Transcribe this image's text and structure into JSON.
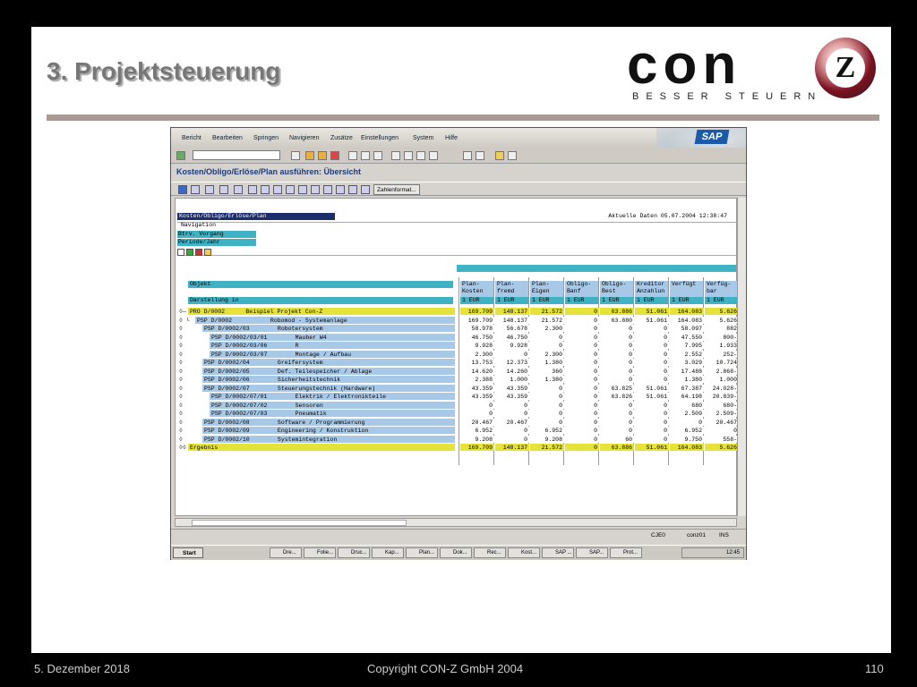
{
  "slide": {
    "title": "3. Projektsteuerung",
    "logo_word": "con",
    "logo_letter": "Z",
    "logo_tagline": "BESSER STEUERN",
    "footer_date": "5. Dezember 2018",
    "footer_copyright": "Copyright CON-Z GmbH 2004",
    "footer_page": "110"
  },
  "sap": {
    "menu": [
      "Bericht",
      "Bearbeiten",
      "Springen",
      "Navigieren",
      "Zusätze",
      "Einstellungen",
      "System",
      "Hilfe"
    ],
    "logo": "SAP",
    "screen_title": "Kosten/Obligo/Erlöse/Plan ausführen: Übersicht",
    "zahlenformat_button": "Zahlenformat...",
    "report_title": "Kosten/Obligo/Erlöse/Plan",
    "aktuell": "Aktuelle Daten 05.07.2004 12:38:47",
    "navigation_label": "Navigation",
    "nav_items": [
      "Btrv. Vorgang",
      "Periode/Jahr"
    ],
    "objekt_label": "Objekt",
    "darstellung_label": "Darstellung in",
    "columns": [
      {
        "l1": "Plan-",
        "l2": "Kosten",
        "unit": "1 EUR"
      },
      {
        "l1": "Plan-",
        "l2": "fremd",
        "unit": "1 EUR"
      },
      {
        "l1": "Plan-",
        "l2": "Eigen",
        "unit": "1 EUR"
      },
      {
        "l1": "Obligo-",
        "l2": "Banf",
        "unit": "1 EUR"
      },
      {
        "l1": "Obligo-",
        "l2": "Best",
        "unit": "1 EUR"
      },
      {
        "l1": "Kreditor",
        "l2": "Anzahlun",
        "unit": "1 EUR"
      },
      {
        "l1": "Verfügt",
        "l2": "",
        "unit": "1 EUR"
      },
      {
        "l1": "Verfüg-",
        "l2": "bar",
        "unit": "1 EUR"
      }
    ],
    "rows": [
      {
        "tree": "◊―",
        "label": "PRO D/0002      Beispiel Projekt Con-Z",
        "indent": 0,
        "hl": true,
        "values": [
          "169.709",
          "148.137",
          "21.572",
          "0",
          "63.886",
          "51.061",
          "164.083",
          "5.626"
        ]
      },
      {
        "tree": "◊ └",
        "label": "PSP D/0002           Robomod - Systemanlage",
        "indent": 1,
        "hl": false,
        "values": [
          "169.709",
          "148.137",
          "21.572",
          "0",
          "63.880",
          "51.061",
          "164.083",
          "5.626"
        ]
      },
      {
        "tree": "◊",
        "label": "PSP D/0002/03        Robotersystem",
        "indent": 2,
        "hl": false,
        "values": [
          "58.978",
          "56.678",
          "2.300",
          "0",
          "0",
          "0",
          "58.097",
          "882"
        ]
      },
      {
        "tree": "◊",
        "label": "PSP D/0002/03/01        Mauber W4",
        "indent": 3,
        "hl": false,
        "values": [
          "46.750",
          "46.750",
          "0",
          "0",
          "0",
          "0",
          "47.550",
          "800-"
        ]
      },
      {
        "tree": "◊",
        "label": "PSP D/0002/03/06        R",
        "indent": 3,
        "hl": false,
        "values": [
          "9.928",
          "9.928",
          "0",
          "0",
          "0",
          "0",
          "7.995",
          "1.933"
        ]
      },
      {
        "tree": "◊",
        "label": "PSP D/0002/03/07        Montage / Aufbau",
        "indent": 3,
        "hl": false,
        "values": [
          "2.300",
          "0",
          "2.300",
          "0",
          "0",
          "0",
          "2.552",
          "252-"
        ]
      },
      {
        "tree": "◊",
        "label": "PSP D/0002/04        Greifersystem",
        "indent": 2,
        "hl": false,
        "values": [
          "13.753",
          "12.373",
          "1.380",
          "0",
          "0",
          "0",
          "3.029",
          "10.724"
        ]
      },
      {
        "tree": "◊",
        "label": "PSP D/0002/05        Def. Teilespeicher / Ablage",
        "indent": 2,
        "hl": false,
        "values": [
          "14.620",
          "14.260",
          "360",
          "0",
          "0",
          "0",
          "17.488",
          "2.868-"
        ]
      },
      {
        "tree": "◊",
        "label": "PSP D/0002/06        Sicherheitstechnik",
        "indent": 2,
        "hl": false,
        "values": [
          "2.388",
          "1.000",
          "1.380",
          "0",
          "0",
          "0",
          "1.380",
          "1.000"
        ]
      },
      {
        "tree": "◊",
        "label": "PSP D/0002/07        Steuerungstechnik (Hardware)",
        "indent": 2,
        "hl": false,
        "values": [
          "43.359",
          "43.359",
          "0",
          "0",
          "63.825",
          "51.061",
          "67.387",
          "24.028-"
        ]
      },
      {
        "tree": "◊",
        "label": "PSP D/0002/07/01        Elektrik / Elektronikteile",
        "indent": 3,
        "hl": false,
        "values": [
          "43.359",
          "43.359",
          "0",
          "0",
          "63.826",
          "51.061",
          "64.198",
          "20.839-"
        ]
      },
      {
        "tree": "◊",
        "label": "PSP D/0002/07/02        Sensoren",
        "indent": 3,
        "hl": false,
        "values": [
          "0",
          "0",
          "0",
          "0",
          "0",
          "0",
          "680",
          "680-"
        ]
      },
      {
        "tree": "◊",
        "label": "PSP D/0002/07/03        Pneumatik",
        "indent": 3,
        "hl": false,
        "values": [
          "0",
          "0",
          "0",
          "0",
          "0",
          "0",
          "2.509",
          "2.509-"
        ]
      },
      {
        "tree": "◊",
        "label": "PSP D/0002/08        Software / Programmierung",
        "indent": 2,
        "hl": false,
        "values": [
          "20.467",
          "20.467",
          "0",
          "0",
          "0",
          "0",
          "0",
          "20.467"
        ]
      },
      {
        "tree": "◊",
        "label": "PSP D/0002/09        Engineering / Konstruktion",
        "indent": 2,
        "hl": false,
        "values": [
          "6.952",
          "0",
          "6.952",
          "0",
          "0",
          "0",
          "6.952",
          "0"
        ]
      },
      {
        "tree": "◊",
        "label": "PSP D/0002/10        Systemintegration",
        "indent": 2,
        "hl": false,
        "values": [
          "9.208",
          "0",
          "9.208",
          "0",
          "60",
          "0",
          "9.750",
          "558-"
        ]
      },
      {
        "tree": "◊◊",
        "label": "Ergebnis",
        "indent": 0,
        "hl": true,
        "res": true,
        "values": [
          "169.709",
          "148.137",
          "21.572",
          "0",
          "63.886",
          "51.061",
          "164.083",
          "5.626"
        ]
      }
    ],
    "status": {
      "system": "CJE0",
      "user": "conz01",
      "mode": "INS"
    },
    "taskbar": {
      "start": "Start",
      "tasks": [
        "Dre...",
        "Folie...",
        "Druc...",
        "Kap...",
        "Plan...",
        "Dok...",
        "Rec...",
        "Kost...",
        "SAP ...",
        "SAP...",
        "Prot..."
      ],
      "clock": "12:45"
    }
  }
}
